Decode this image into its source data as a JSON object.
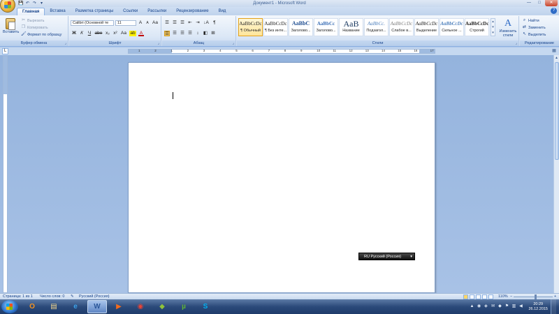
{
  "window": {
    "title": "Документ1 - Microsoft Word",
    "controls": {
      "minimize": "—",
      "maximize": "□",
      "close": "✕"
    }
  },
  "qat": {
    "save": "💾",
    "undo": "↶",
    "redo": "↷",
    "customize": "▾"
  },
  "tabs": [
    {
      "label": "Главная",
      "active": true
    },
    {
      "label": "Вставка"
    },
    {
      "label": "Разметка страницы"
    },
    {
      "label": "Ссылки"
    },
    {
      "label": "Рассылки"
    },
    {
      "label": "Рецензирование"
    },
    {
      "label": "Вид"
    }
  ],
  "help": "?",
  "ribbon": {
    "clipboard": {
      "label": "Буфер обмена",
      "paste": "Вставить",
      "cut": "Вырезать",
      "copy": "Копировать",
      "format_painter": "Формат по образцу"
    },
    "font": {
      "label": "Шрифт",
      "font_name": "Calibri (Основной те",
      "font_size": "11",
      "grow": "A",
      "shrink": "A",
      "clear": "Aa",
      "bold": "Ж",
      "italic": "К",
      "underline": "Ч",
      "strike": "abe",
      "subscript": "x₂",
      "superscript": "x²",
      "change_case": "Aa",
      "highlight": "ab",
      "font_color": "A"
    },
    "paragraph": {
      "label": "Абзац",
      "bullets": "☰",
      "numbering": "☰",
      "multilevel": "☰",
      "decrease_indent": "⇤",
      "increase_indent": "⇥",
      "sort": "↓A",
      "show_marks": "¶",
      "line_spacing": "↕",
      "shading": "◧",
      "borders": "⊞"
    },
    "styles": {
      "label": "Стили",
      "items": [
        {
          "sample": "AaBbCcDc",
          "name": "¶ Обычный",
          "selected": true
        },
        {
          "sample": "AaBbCcDc",
          "name": "¶ Без инте..."
        },
        {
          "sample": "AaBbC",
          "name": "Заголово..."
        },
        {
          "sample": "AaBbCc",
          "name": "Заголово..."
        },
        {
          "sample": "AaB",
          "name": "Название"
        },
        {
          "sample": "AaBbCc.",
          "name": "Подзагол..."
        },
        {
          "sample": "AaBbCcDc",
          "name": "Слабое в..."
        },
        {
          "sample": "AaBbCcDc",
          "name": "Выделение"
        },
        {
          "sample": "AaBbCcDc",
          "name": "Сильное ..."
        },
        {
          "sample": "AaBbCcDc",
          "name": "Строгий"
        }
      ],
      "change_styles": "Изменить стили",
      "change_icon": "A"
    },
    "editing": {
      "label": "Редактирование",
      "find": "Найти",
      "replace": "Заменить",
      "select": "Выделить"
    }
  },
  "ruler": {
    "corner": "L",
    "numbers": [
      "1",
      "2",
      "1",
      "2",
      "3",
      "4",
      "5",
      "6",
      "7",
      "8",
      "9",
      "10",
      "11",
      "12",
      "13",
      "14",
      "15",
      "16",
      "17"
    ]
  },
  "language_popup": {
    "text": "RU Русский (Россия)",
    "arrow": "▾"
  },
  "status": {
    "page": "Страница: 1 из 1",
    "words": "Число слов: 0",
    "language": "Русский (Россия)",
    "zoom": "110%",
    "zoom_out": "−",
    "zoom_in": "+"
  },
  "taskbar": {
    "apps": [
      {
        "name": "odnoklassniki",
        "glyph": "О",
        "color": "#f7931e"
      },
      {
        "name": "explorer",
        "glyph": "▤",
        "color": "#f2d58c"
      },
      {
        "name": "ie",
        "glyph": "e",
        "color": "#3aa0e8"
      },
      {
        "name": "word",
        "glyph": "W",
        "color": "#2b579a",
        "active": true
      },
      {
        "name": "media-player",
        "glyph": "▶",
        "color": "#f26b1d"
      },
      {
        "name": "chrome",
        "glyph": "◉",
        "color": "#e94335"
      },
      {
        "name": "winrar",
        "glyph": "◆",
        "color": "#8fc33a"
      },
      {
        "name": "utorrent",
        "glyph": "µ",
        "color": "#5fb336"
      },
      {
        "name": "skype",
        "glyph": "S",
        "color": "#00aff0"
      }
    ],
    "clock_time": "20:29",
    "clock_date": "26.12.2015"
  }
}
